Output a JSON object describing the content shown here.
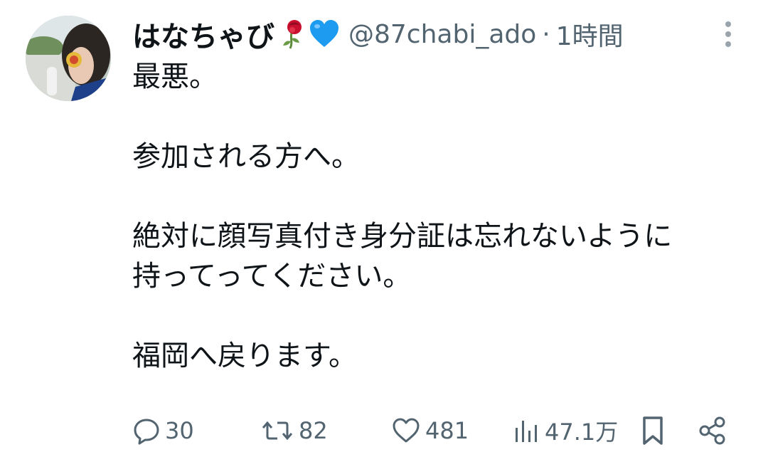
{
  "tweet": {
    "display_name": "はなちゃび",
    "name_emojis": [
      "wilted-rose-emoji",
      "blue-heart-emoji"
    ],
    "handle": "@87chabi_ado",
    "separator": "·",
    "timestamp": "1時間",
    "body": "最悪。\n\n参加される方へ。\n\n絶対に顔写真付き身分証は忘れないように\n持ってってください。\n\n福岡へ戻ります。"
  },
  "actions": {
    "reply_count": "30",
    "retweet_count": "82",
    "like_count": "481",
    "view_count": "47.1万"
  },
  "colors": {
    "text": "#0f1419",
    "secondary": "#536471",
    "heart_blue": "#1d9bf0",
    "rose_red": "#c8102e",
    "background": "#ffffff"
  }
}
